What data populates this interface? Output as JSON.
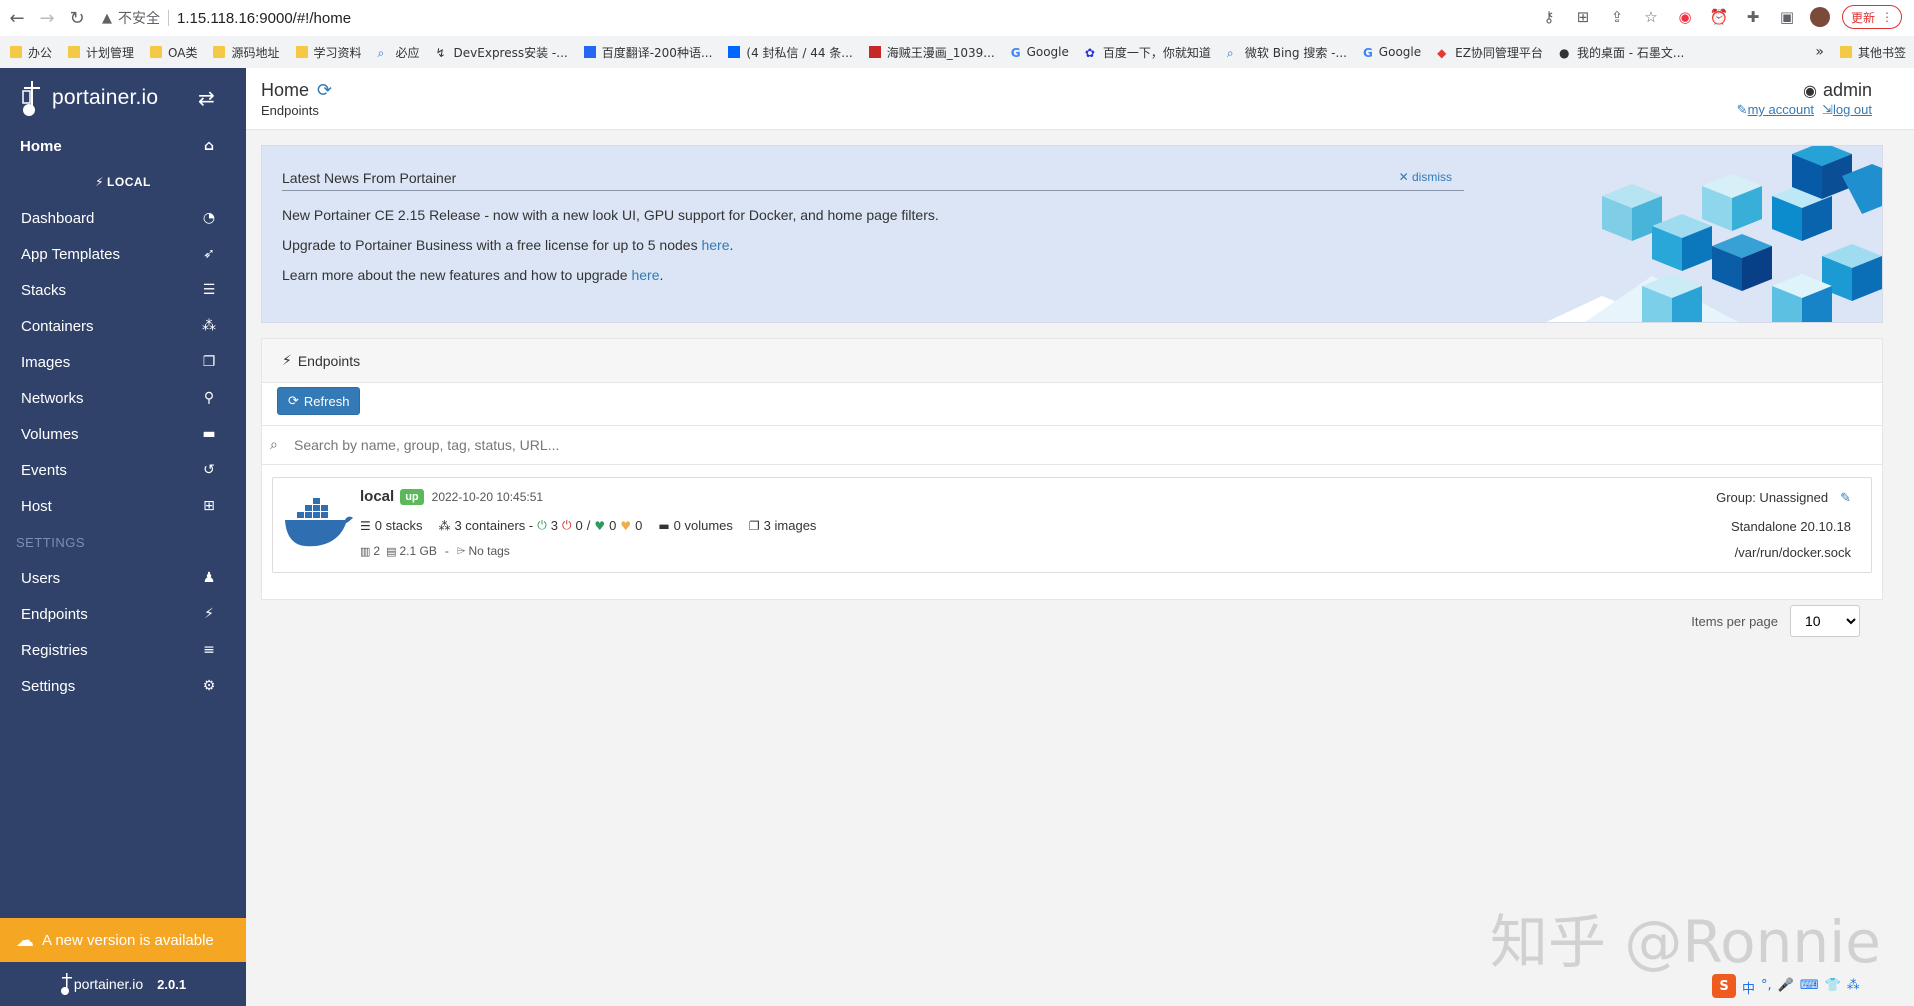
{
  "browser": {
    "insecure_label": "不安全",
    "url": "1.15.118.16:9000/#!/home",
    "update_label": "更新",
    "bookmarks": [
      "办公",
      "计划管理",
      "OA类",
      "源码地址",
      "学习资料",
      "必应",
      "DevExpress安装 -...",
      "百度翻译-200种语...",
      "(4 封私信 / 44 条...",
      "海贼王漫画_1039...",
      "Google",
      "百度一下，你就知道",
      "微软 Bing 搜索 -...",
      "Google",
      "EZ协同管理平台",
      "我的桌面 - 石墨文..."
    ],
    "bookmarks_more": "»",
    "other_bookmarks": "其他书签"
  },
  "sidebar": {
    "logo": "portainer.io",
    "home": "Home",
    "endpoint": "LOCAL",
    "items": [
      "Dashboard",
      "App Templates",
      "Stacks",
      "Containers",
      "Images",
      "Networks",
      "Volumes",
      "Events",
      "Host"
    ],
    "settings_heading": "SETTINGS",
    "settings_items": [
      "Users",
      "Endpoints",
      "Registries",
      "Settings"
    ],
    "new_version": "A new version is available",
    "footer_logo": "portainer.io",
    "version": "2.0.1"
  },
  "header": {
    "title": "Home",
    "breadcrumb": "Endpoints",
    "user": "admin",
    "my_account": "my account",
    "log_out": "log out"
  },
  "news": {
    "title": "Latest News From Portainer",
    "dismiss": "dismiss",
    "line1": "New Portainer CE 2.15 Release - now with a new look UI, GPU support for Docker, and home page filters.",
    "line2": "Upgrade to Portainer Business with a free license for up to 5 nodes ",
    "line2_link": "here",
    "line3": "Learn more about the new features and how to upgrade ",
    "line3_link": "here"
  },
  "endpoints": {
    "heading": "Endpoints",
    "refresh": "Refresh",
    "search_placeholder": "Search by name, group, tag, status, URL...",
    "items_per_page_label": "Items per page",
    "items_per_page": "10",
    "list": [
      {
        "name": "local",
        "status": "up",
        "timestamp": "2022-10-20 10:45:51",
        "stacks": "0 stacks",
        "containers": "3 containers -",
        "running": "3",
        "stopped": "0",
        "healthy": "0",
        "unhealthy": "0",
        "volumes": "0 volumes",
        "images": "3 images",
        "cpu": "2",
        "memory": "2.1 GB",
        "sep": "-",
        "tags": "No tags",
        "group": "Group: Unassigned",
        "type": "Standalone 20.10.18",
        "url": "/var/run/docker.sock"
      }
    ]
  },
  "watermark": "知乎 @Ronnie",
  "ime": [
    "S",
    "中",
    "°,",
    "🎤",
    "⌨",
    "👕",
    "⁂"
  ],
  "colors": {
    "sidebar_bg": "#30426a",
    "accent": "#337ab7",
    "status_up": "#5cb85c",
    "new_version_bg": "#f5a623"
  }
}
